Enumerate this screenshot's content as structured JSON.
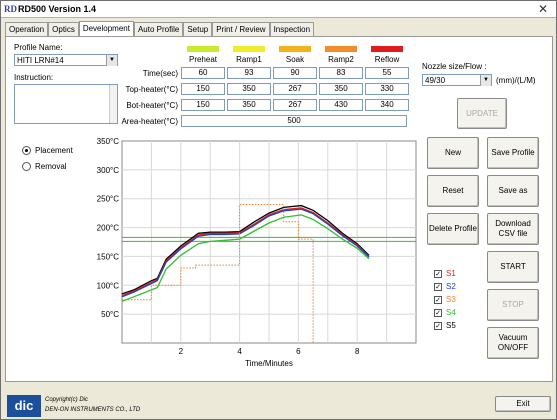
{
  "window": {
    "title": "RD500 Version 1.4",
    "app_icon": "RD"
  },
  "tabs": [
    "Operation",
    "Optics",
    "Development",
    "Auto Profile",
    "Setup",
    "Print / Review",
    "Inspection"
  ],
  "active_tab": "Development",
  "profile": {
    "label": "Profile Name:",
    "value": "HITI LRN#14"
  },
  "instruction": {
    "label": "Instruction:"
  },
  "zones": [
    {
      "name": "Preheat",
      "color": "#c8ec2c"
    },
    {
      "name": "Ramp1",
      "color": "#f0ec2c"
    },
    {
      "name": "Soak",
      "color": "#f4b21a"
    },
    {
      "name": "Ramp2",
      "color": "#f48c2c"
    },
    {
      "name": "Reflow",
      "color": "#e01c1c"
    }
  ],
  "rows": [
    {
      "label": "Time(sec)",
      "values": [
        "60",
        "93",
        "90",
        "83",
        "55"
      ]
    },
    {
      "label": "Top-heater(°C)",
      "values": [
        "150",
        "350",
        "267",
        "350",
        "330"
      ]
    },
    {
      "label": "Bot-heater(°C)",
      "values": [
        "150",
        "350",
        "267",
        "430",
        "340"
      ]
    }
  ],
  "area_heater": {
    "label": "Area-heater(°C)",
    "value": "500"
  },
  "nozzle": {
    "label": "Nozzle size/Flow :",
    "value": "49/30",
    "unit": "(mm)/(L/M)"
  },
  "buttons": {
    "update": "UPDATE",
    "new": "New",
    "save_profile": "Save Profile",
    "reset": "Reset",
    "save_as": "Save as",
    "delete_profile": "Delete Profile",
    "download_csv": "Download CSV file",
    "start": "START",
    "stop": "STOP",
    "vacuum": "Vacuum ON/OFF",
    "exit": "Exit"
  },
  "modes": [
    {
      "label": "Placement",
      "selected": true
    },
    {
      "label": "Removal",
      "selected": false
    }
  ],
  "sensors": [
    {
      "label": "S1",
      "color": "#e01c1c",
      "checked": true
    },
    {
      "label": "S2",
      "color": "#2040c0",
      "checked": true
    },
    {
      "label": "S3",
      "color": "#f08030",
      "checked": true
    },
    {
      "label": "S4",
      "color": "#30c030",
      "checked": true
    },
    {
      "label": "S5",
      "color": "#000000",
      "checked": true
    }
  ],
  "footer": {
    "copyright": "Copyright(c) Dic",
    "company": "DEN-ON INSTRUMENTS CO., LTD",
    "logo": "dic"
  },
  "chart_data": {
    "type": "line",
    "xlabel": "Time/Minutes",
    "xlim": [
      0,
      10
    ],
    "ylim": [
      0,
      350
    ],
    "xticks": [
      2,
      4,
      6,
      8
    ],
    "yticks": [
      {
        "v": 50,
        "label": "50°C"
      },
      {
        "v": 100,
        "label": "100°C"
      },
      {
        "v": 150,
        "label": "150°C"
      },
      {
        "v": 200,
        "label": "200°C"
      },
      {
        "v": 250,
        "label": "250°C"
      },
      {
        "v": 300,
        "label": "300°C"
      },
      {
        "v": 350,
        "label": "350°C"
      }
    ],
    "grid": true,
    "reference_lines": [
      {
        "y": 183,
        "color": "#30c030"
      },
      {
        "y": 176,
        "color": "#30c030"
      }
    ],
    "series": [
      {
        "name": "S5",
        "color": "#000000",
        "points": [
          [
            0,
            85
          ],
          [
            0.4,
            92
          ],
          [
            1,
            108
          ],
          [
            1.2,
            112
          ],
          [
            1.5,
            145
          ],
          [
            2,
            168
          ],
          [
            2.6,
            190
          ],
          [
            3,
            192
          ],
          [
            3.5,
            192
          ],
          [
            4,
            193
          ],
          [
            4.5,
            210
          ],
          [
            5,
            225
          ],
          [
            5.5,
            235
          ],
          [
            6.1,
            238
          ],
          [
            6.5,
            230
          ],
          [
            7,
            212
          ],
          [
            7.5,
            190
          ],
          [
            8,
            172
          ],
          [
            8.4,
            152
          ]
        ]
      },
      {
        "name": "S1",
        "color": "#e01c1c",
        "points": [
          [
            0,
            82
          ],
          [
            0.4,
            90
          ],
          [
            1,
            105
          ],
          [
            1.2,
            110
          ],
          [
            1.5,
            142
          ],
          [
            2,
            165
          ],
          [
            2.6,
            187
          ],
          [
            3,
            190
          ],
          [
            3.5,
            190
          ],
          [
            4,
            191
          ],
          [
            4.5,
            206
          ],
          [
            5,
            222
          ],
          [
            5.5,
            231
          ],
          [
            6.1,
            234
          ],
          [
            6.5,
            226
          ],
          [
            7,
            208
          ],
          [
            7.5,
            188
          ],
          [
            8,
            170
          ],
          [
            8.4,
            150
          ]
        ]
      },
      {
        "name": "S2",
        "color": "#2040c0",
        "points": [
          [
            0,
            80
          ],
          [
            0.4,
            88
          ],
          [
            1,
            103
          ],
          [
            1.2,
            108
          ],
          [
            1.5,
            140
          ],
          [
            2,
            163
          ],
          [
            2.6,
            185
          ],
          [
            3,
            188
          ],
          [
            3.5,
            188
          ],
          [
            4,
            189
          ],
          [
            4.5,
            204
          ],
          [
            5,
            220
          ],
          [
            5.5,
            229
          ],
          [
            6.1,
            232
          ],
          [
            6.5,
            224
          ],
          [
            7,
            206
          ],
          [
            7.5,
            186
          ],
          [
            8,
            168
          ],
          [
            8.4,
            149
          ]
        ]
      },
      {
        "name": "S4",
        "color": "#30c030",
        "points": [
          [
            0,
            72
          ],
          [
            0.4,
            80
          ],
          [
            1,
            92
          ],
          [
            1.2,
            96
          ],
          [
            1.5,
            128
          ],
          [
            2,
            152
          ],
          [
            2.6,
            172
          ],
          [
            3,
            176
          ],
          [
            3.5,
            178
          ],
          [
            4,
            180
          ],
          [
            4.5,
            194
          ],
          [
            5,
            208
          ],
          [
            5.5,
            218
          ],
          [
            6.1,
            222
          ],
          [
            6.5,
            214
          ],
          [
            7,
            198
          ],
          [
            7.5,
            180
          ],
          [
            8,
            164
          ],
          [
            8.4,
            146
          ]
        ]
      },
      {
        "name": "S3",
        "color": "#f08030",
        "style": "dotted",
        "points": [
          [
            0,
            75
          ],
          [
            1,
            75
          ],
          [
            1,
            100
          ],
          [
            2,
            100
          ],
          [
            2,
            130
          ],
          [
            2.5,
            130
          ],
          [
            2.5,
            135
          ],
          [
            4,
            135
          ],
          [
            4,
            240
          ],
          [
            5.5,
            240
          ],
          [
            5.5,
            210
          ],
          [
            6,
            210
          ],
          [
            6,
            180
          ],
          [
            6.5,
            180
          ],
          [
            6.5,
            0
          ]
        ]
      }
    ]
  }
}
